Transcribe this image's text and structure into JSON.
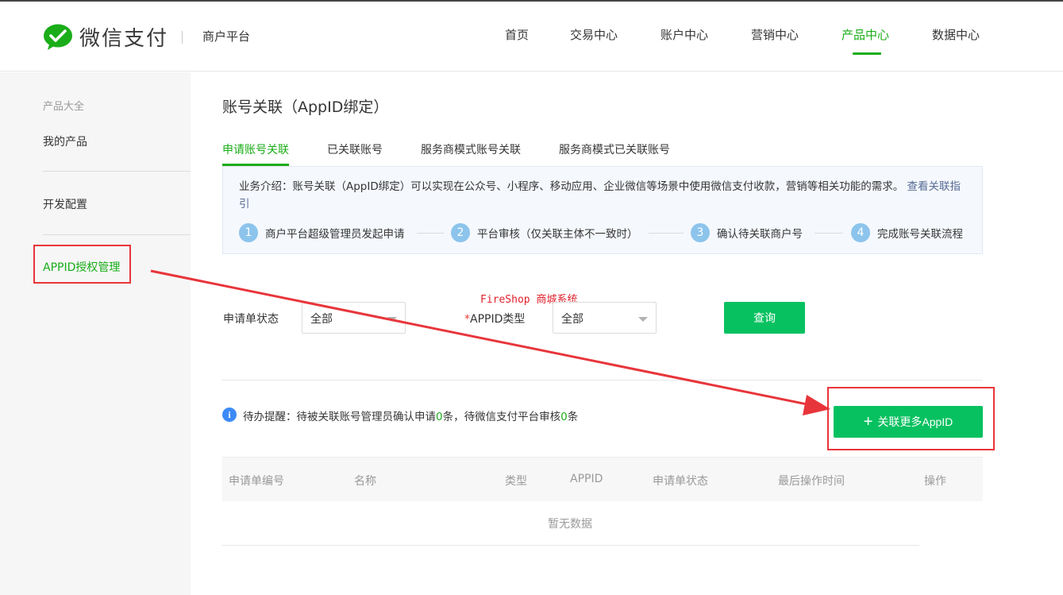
{
  "header": {
    "brand": "微信支付",
    "platform": "商户平台",
    "nav": [
      {
        "label": "首页"
      },
      {
        "label": "交易中心"
      },
      {
        "label": "账户中心"
      },
      {
        "label": "营销中心"
      },
      {
        "label": "产品中心"
      },
      {
        "label": "数据中心"
      }
    ],
    "active_nav": "产品中心"
  },
  "sidebar": {
    "group_title": "产品大全",
    "items": [
      {
        "label": "我的产品"
      },
      {
        "label": "开发配置"
      },
      {
        "label": "APPID授权管理"
      }
    ],
    "active_item": "APPID授权管理"
  },
  "main": {
    "title": "账号关联（AppID绑定）",
    "tabs": [
      {
        "label": "申请账号关联"
      },
      {
        "label": "已关联账号"
      },
      {
        "label": "服务商模式账号关联"
      },
      {
        "label": "服务商模式已关联账号"
      }
    ],
    "active_tab": "申请账号关联",
    "intro": {
      "text": "业务介绍：账号关联（AppID绑定）可以实现在公众号、小程序、移动应用、企业微信等场景中使用微信支付收款，营销等相关功能的需求。",
      "link": "查看关联指引"
    },
    "steps": [
      {
        "num": "1",
        "label": "商户平台超级管理员发起申请"
      },
      {
        "num": "2",
        "label": "平台审核（仅关联主体不一致时）"
      },
      {
        "num": "3",
        "label": "确认待关联商户号"
      },
      {
        "num": "4",
        "label": "完成账号关联流程"
      }
    ],
    "watermark": "FireShop 商城系统",
    "filters": {
      "status_label": "申请单状态",
      "status_value": "全部",
      "required_mark": "*",
      "appid_type_label": "APPID类型",
      "appid_type_value": "全部",
      "query_button": "查询"
    },
    "todo": {
      "icon": "i",
      "prefix": "待办提醒：待被关联账号管理员确认申请",
      "count1": "0",
      "middle": "条，待微信支付平台审核",
      "count2": "0",
      "suffix": "条"
    },
    "add_button": {
      "plus": "+",
      "label": "关联更多AppID"
    },
    "table": {
      "columns": [
        "申请单编号",
        "名称",
        "类型",
        "APPID",
        "申请单状态",
        "最后操作时间",
        "操作"
      ],
      "empty_text": "暂无数据"
    }
  },
  "colors": {
    "brand_green": "#07c160",
    "active_green": "#1aad19",
    "annotation_red": "#e8353b",
    "link_blue": "#576b95",
    "step_blue": "#8cc4ec"
  }
}
